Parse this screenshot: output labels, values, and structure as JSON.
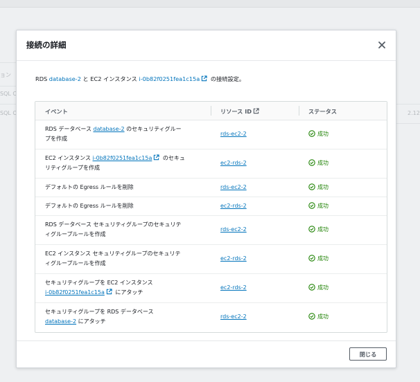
{
  "background": {
    "fragments": [
      "ョン",
      "SQL C",
      "SQL C",
      "2.12"
    ]
  },
  "modal": {
    "title": "接続の詳細",
    "description": {
      "part1": "RDS ",
      "db_link": "database-2",
      "part2": " と EC2 インスタンス ",
      "instance_link": "i-0b82f0251fea1c15a",
      "part3": " の接続設定。"
    },
    "table": {
      "headers": {
        "event": "イベント",
        "resource_id": "リソース ID",
        "status": "ステータス"
      },
      "rows": [
        {
          "event_line1_pre": "RDS データベース ",
          "event_line1_link": "database-2",
          "event_line1_post": " のセキュリティグルー",
          "event_line2": "プを作成",
          "resource": "rds-ec2-2",
          "status": "成功"
        },
        {
          "event_line1_pre": "EC2 インスタンス ",
          "event_line1_link": "i-0b82f0251fea1c15a",
          "event_line1_post": " のセキュ",
          "event_line2": "リティグループを作成",
          "resource": "ec2-rds-2",
          "status": "成功"
        },
        {
          "event": "デフォルトの Egress ルールを削除",
          "resource": "rds-ec2-2",
          "status": "成功"
        },
        {
          "event": "デフォルトの Egress ルールを削除",
          "resource": "ec2-rds-2",
          "status": "成功"
        },
        {
          "event_line1": "RDS データベース セキュリティグループのセキュリテ",
          "event_line2": "ィグループルールを作成",
          "resource": "rds-ec2-2",
          "status": "成功"
        },
        {
          "event_line1": "EC2 インスタンス セキュリティグループのセキュリテ",
          "event_line2": "ィグループルールを作成",
          "resource": "ec2-rds-2",
          "status": "成功"
        },
        {
          "event_line1": "セキュリティグループを EC2 インスタンス",
          "event_line2_link": "i-0b82f0251fea1c15a",
          "event_line2_post": " にアタッチ",
          "resource": "ec2-rds-2",
          "status": "成功"
        },
        {
          "event_line1": "セキュリティグループを RDS データベース",
          "event_line2_link": "database-2",
          "event_line2_post": " にアタッチ",
          "resource": "rds-ec2-2",
          "status": "成功"
        }
      ]
    },
    "footer": {
      "close_label": "閉じる"
    },
    "icons": {
      "close": "close-icon",
      "external": "external-link-icon",
      "success": "check-circle-icon"
    },
    "colors": {
      "link": "#0073bb",
      "success": "#1d8102",
      "text": "#16191f"
    }
  }
}
